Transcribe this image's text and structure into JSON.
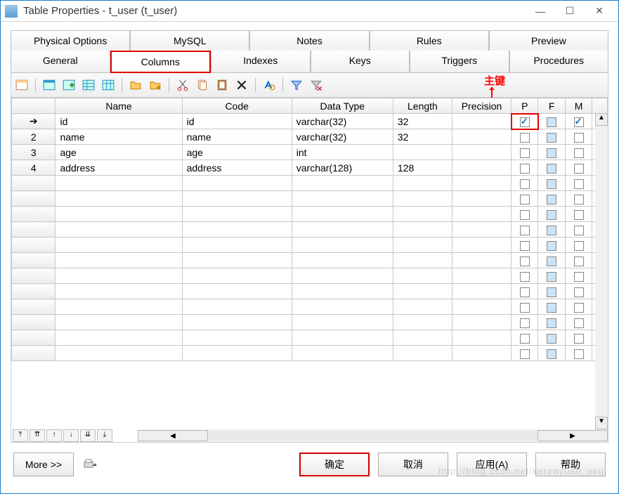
{
  "window": {
    "title": "Table Properties - t_user (t_user)"
  },
  "tabs_row1": [
    "Physical Options",
    "MySQL",
    "Notes",
    "Rules",
    "Preview"
  ],
  "tabs_row2": [
    "General",
    "Columns",
    "Indexes",
    "Keys",
    "Triggers",
    "Procedures"
  ],
  "active_tab": "Columns",
  "annotation": {
    "label": "主键"
  },
  "columns_grid": {
    "headers": {
      "name": "Name",
      "code": "Code",
      "data_type": "Data Type",
      "length": "Length",
      "precision": "Precision",
      "p": "P",
      "f": "F",
      "m": "M"
    },
    "rows": [
      {
        "rownum": "➔",
        "name": "id",
        "code": "id",
        "data_type": "varchar(32)",
        "length": "32",
        "precision": "",
        "p": true,
        "f": false,
        "m": true
      },
      {
        "rownum": "2",
        "name": "name",
        "code": "name",
        "data_type": "varchar(32)",
        "length": "32",
        "precision": "",
        "p": false,
        "f": false,
        "m": false
      },
      {
        "rownum": "3",
        "name": "age",
        "code": "age",
        "data_type": "int",
        "length": "",
        "precision": "",
        "p": false,
        "f": false,
        "m": false
      },
      {
        "rownum": "4",
        "name": "address",
        "code": "address",
        "data_type": "varchar(128)",
        "length": "128",
        "precision": "",
        "p": false,
        "f": false,
        "m": false
      }
    ],
    "empty_rows": 12
  },
  "footer": {
    "more": "More >>",
    "ok": "确定",
    "cancel": "取消",
    "apply": "应用(A)",
    "help": "帮助"
  },
  "watermark": "http://blog.csdn.net/kerenyuan_pku"
}
